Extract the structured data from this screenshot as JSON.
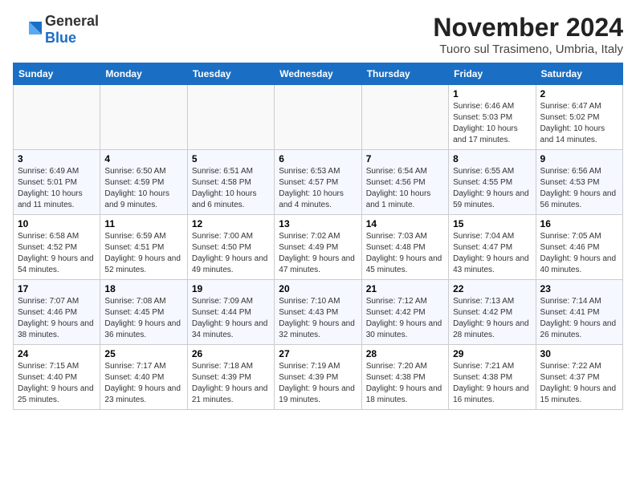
{
  "header": {
    "logo_general": "General",
    "logo_blue": "Blue",
    "month_title": "November 2024",
    "location": "Tuoro sul Trasimeno, Umbria, Italy"
  },
  "weekdays": [
    "Sunday",
    "Monday",
    "Tuesday",
    "Wednesday",
    "Thursday",
    "Friday",
    "Saturday"
  ],
  "weeks": [
    [
      {
        "day": "",
        "info": ""
      },
      {
        "day": "",
        "info": ""
      },
      {
        "day": "",
        "info": ""
      },
      {
        "day": "",
        "info": ""
      },
      {
        "day": "",
        "info": ""
      },
      {
        "day": "1",
        "info": "Sunrise: 6:46 AM\nSunset: 5:03 PM\nDaylight: 10 hours and 17 minutes."
      },
      {
        "day": "2",
        "info": "Sunrise: 6:47 AM\nSunset: 5:02 PM\nDaylight: 10 hours and 14 minutes."
      }
    ],
    [
      {
        "day": "3",
        "info": "Sunrise: 6:49 AM\nSunset: 5:01 PM\nDaylight: 10 hours and 11 minutes."
      },
      {
        "day": "4",
        "info": "Sunrise: 6:50 AM\nSunset: 4:59 PM\nDaylight: 10 hours and 9 minutes."
      },
      {
        "day": "5",
        "info": "Sunrise: 6:51 AM\nSunset: 4:58 PM\nDaylight: 10 hours and 6 minutes."
      },
      {
        "day": "6",
        "info": "Sunrise: 6:53 AM\nSunset: 4:57 PM\nDaylight: 10 hours and 4 minutes."
      },
      {
        "day": "7",
        "info": "Sunrise: 6:54 AM\nSunset: 4:56 PM\nDaylight: 10 hours and 1 minute."
      },
      {
        "day": "8",
        "info": "Sunrise: 6:55 AM\nSunset: 4:55 PM\nDaylight: 9 hours and 59 minutes."
      },
      {
        "day": "9",
        "info": "Sunrise: 6:56 AM\nSunset: 4:53 PM\nDaylight: 9 hours and 56 minutes."
      }
    ],
    [
      {
        "day": "10",
        "info": "Sunrise: 6:58 AM\nSunset: 4:52 PM\nDaylight: 9 hours and 54 minutes."
      },
      {
        "day": "11",
        "info": "Sunrise: 6:59 AM\nSunset: 4:51 PM\nDaylight: 9 hours and 52 minutes."
      },
      {
        "day": "12",
        "info": "Sunrise: 7:00 AM\nSunset: 4:50 PM\nDaylight: 9 hours and 49 minutes."
      },
      {
        "day": "13",
        "info": "Sunrise: 7:02 AM\nSunset: 4:49 PM\nDaylight: 9 hours and 47 minutes."
      },
      {
        "day": "14",
        "info": "Sunrise: 7:03 AM\nSunset: 4:48 PM\nDaylight: 9 hours and 45 minutes."
      },
      {
        "day": "15",
        "info": "Sunrise: 7:04 AM\nSunset: 4:47 PM\nDaylight: 9 hours and 43 minutes."
      },
      {
        "day": "16",
        "info": "Sunrise: 7:05 AM\nSunset: 4:46 PM\nDaylight: 9 hours and 40 minutes."
      }
    ],
    [
      {
        "day": "17",
        "info": "Sunrise: 7:07 AM\nSunset: 4:46 PM\nDaylight: 9 hours and 38 minutes."
      },
      {
        "day": "18",
        "info": "Sunrise: 7:08 AM\nSunset: 4:45 PM\nDaylight: 9 hours and 36 minutes."
      },
      {
        "day": "19",
        "info": "Sunrise: 7:09 AM\nSunset: 4:44 PM\nDaylight: 9 hours and 34 minutes."
      },
      {
        "day": "20",
        "info": "Sunrise: 7:10 AM\nSunset: 4:43 PM\nDaylight: 9 hours and 32 minutes."
      },
      {
        "day": "21",
        "info": "Sunrise: 7:12 AM\nSunset: 4:42 PM\nDaylight: 9 hours and 30 minutes."
      },
      {
        "day": "22",
        "info": "Sunrise: 7:13 AM\nSunset: 4:42 PM\nDaylight: 9 hours and 28 minutes."
      },
      {
        "day": "23",
        "info": "Sunrise: 7:14 AM\nSunset: 4:41 PM\nDaylight: 9 hours and 26 minutes."
      }
    ],
    [
      {
        "day": "24",
        "info": "Sunrise: 7:15 AM\nSunset: 4:40 PM\nDaylight: 9 hours and 25 minutes."
      },
      {
        "day": "25",
        "info": "Sunrise: 7:17 AM\nSunset: 4:40 PM\nDaylight: 9 hours and 23 minutes."
      },
      {
        "day": "26",
        "info": "Sunrise: 7:18 AM\nSunset: 4:39 PM\nDaylight: 9 hours and 21 minutes."
      },
      {
        "day": "27",
        "info": "Sunrise: 7:19 AM\nSunset: 4:39 PM\nDaylight: 9 hours and 19 minutes."
      },
      {
        "day": "28",
        "info": "Sunrise: 7:20 AM\nSunset: 4:38 PM\nDaylight: 9 hours and 18 minutes."
      },
      {
        "day": "29",
        "info": "Sunrise: 7:21 AM\nSunset: 4:38 PM\nDaylight: 9 hours and 16 minutes."
      },
      {
        "day": "30",
        "info": "Sunrise: 7:22 AM\nSunset: 4:37 PM\nDaylight: 9 hours and 15 minutes."
      }
    ]
  ]
}
